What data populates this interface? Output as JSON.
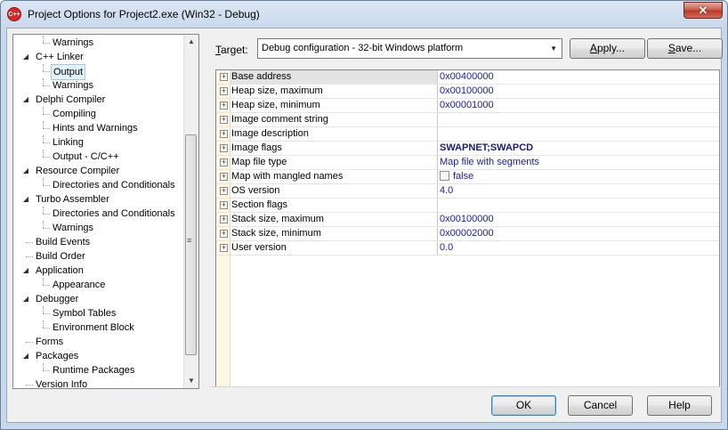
{
  "window": {
    "title": "Project Options for Project2.exe  (Win32 - Debug)",
    "close_symbol": "✕",
    "app_icon_text": "C++"
  },
  "tree": {
    "items": [
      {
        "label": "Warnings",
        "level": 2
      },
      {
        "label": "C++ Linker",
        "level": 1,
        "expanded": true
      },
      {
        "label": "Output",
        "level": 2,
        "selected": true
      },
      {
        "label": "Warnings",
        "level": 2
      },
      {
        "label": "Delphi Compiler",
        "level": 1,
        "expanded": true
      },
      {
        "label": "Compiling",
        "level": 2
      },
      {
        "label": "Hints and Warnings",
        "level": 2
      },
      {
        "label": "Linking",
        "level": 2
      },
      {
        "label": "Output - C/C++",
        "level": 2
      },
      {
        "label": "Resource Compiler",
        "level": 1,
        "expanded": true
      },
      {
        "label": "Directories and Conditionals",
        "level": 2
      },
      {
        "label": "Turbo Assembler",
        "level": 1,
        "expanded": true
      },
      {
        "label": "Directories and Conditionals",
        "level": 2
      },
      {
        "label": "Warnings",
        "level": 2
      },
      {
        "label": "Build Events",
        "level": 1
      },
      {
        "label": "Build Order",
        "level": 1
      },
      {
        "label": "Application",
        "level": 1,
        "expanded": true
      },
      {
        "label": "Appearance",
        "level": 2
      },
      {
        "label": "Debugger",
        "level": 1,
        "expanded": true
      },
      {
        "label": "Symbol Tables",
        "level": 2
      },
      {
        "label": "Environment Block",
        "level": 2
      },
      {
        "label": "Forms",
        "level": 1
      },
      {
        "label": "Packages",
        "level": 1,
        "expanded": true
      },
      {
        "label": "Runtime Packages",
        "level": 2
      },
      {
        "label": "Version Info",
        "level": 1
      }
    ]
  },
  "target": {
    "label_accel": "T",
    "label_rest": "arget:",
    "value": "Debug configuration - 32-bit Windows platform"
  },
  "buttons": {
    "apply_accel": "A",
    "apply_rest": "pply...",
    "save_accel": "S",
    "save_rest": "ave...",
    "ok": "OK",
    "cancel": "Cancel",
    "help": "Help"
  },
  "properties": [
    {
      "name": "Base address",
      "value": "0x00400000",
      "selected": true
    },
    {
      "name": "Heap size, maximum",
      "value": "0x00100000"
    },
    {
      "name": "Heap size, minimum",
      "value": "0x00001000"
    },
    {
      "name": "Image comment string",
      "value": ""
    },
    {
      "name": "Image description",
      "value": ""
    },
    {
      "name": "Image flags",
      "value": "SWAPNET;SWAPCD",
      "bold": true
    },
    {
      "name": "Map file type",
      "value": "Map file with segments"
    },
    {
      "name": "Map with mangled names",
      "value": "false",
      "checkbox": true
    },
    {
      "name": "OS version",
      "value": "4.0"
    },
    {
      "name": "Section flags",
      "value": ""
    },
    {
      "name": "Stack size, maximum",
      "value": "0x00100000"
    },
    {
      "name": "Stack size, minimum",
      "value": "0x00002000"
    },
    {
      "name": "User version",
      "value": "0.0"
    }
  ],
  "icons": {
    "expand": "plus-box-icon",
    "collapse": "triangle-down-icon",
    "scroll_up": "arrow-up-icon",
    "scroll_down": "arrow-down-icon",
    "dropdown": "chevron-down-icon"
  }
}
